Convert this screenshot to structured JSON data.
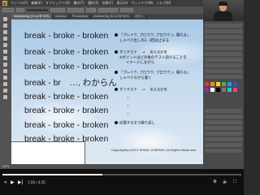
{
  "menu": {
    "app_logo": "Ai",
    "items": [
      "ファイル(F)",
      "編集(E)",
      "オブジェクト(O)",
      "書式(T)",
      "選択(S)",
      "効果(C)",
      "表示(V)",
      "ウィンドウ(W)",
      "ヘルプ(H)"
    ]
  },
  "tabs": [
    {
      "label": "shadowing_01.ai @ 50%",
      "active": true
    },
    {
      "label": "Ilstrator",
      "active": false
    },
    {
      "label": "Photoshop",
      "active": false
    },
    {
      "label": "shadowing_02.ai @ 50%",
      "active": false
    },
    {
      "label": "ボタン",
      "active": false
    }
  ],
  "phrases": [
    "break - broke - broken",
    "break - broke - broken",
    "break - broke - broken",
    "break - br　…, わからん",
    "break - broke - broken",
    "break - broke - braken",
    "break - broke - broken",
    "break - broke - broken"
  ],
  "notes": {
    "note1_line1": "「ブレイク, ブロウク, ブロウクン, 壊れる」",
    "note1_line2": "しゃべり出しの2, 3回は止まる",
    "note2_line1": "すぐテスト 　→ 　言えるかを",
    "note2_line2": "※ポイントはどの後のテスト読けることを",
    "note2_line3": "イメージしながら",
    "note3_line1": "「ブレイク, ブロウク, ブロウクン, 壊れる」",
    "note3_line2": "しゃべりながら書く",
    "note4_line1": "すぐテスト 　→ 　言えるかを",
    "note5_line1": "記憶するまで繰り返し",
    "dots": [
      "・",
      "・",
      "・"
    ]
  },
  "copyright": "Copyright(c)2015 NOMA COMPASS All Rights Reserved.",
  "status": {
    "zoom": "50%"
  },
  "player": {
    "progress": 0.42,
    "timecode": "1:56 / 4:35",
    "play_icon": "▶",
    "back_icon": "«",
    "next_icon": "▶|",
    "volume_icon": "🔈",
    "settings_icon": "⚙",
    "fullscreen_icon": "⛶"
  },
  "colors": {
    "accent": "#e8a33a",
    "swatches": [
      "#e23b2e",
      "#f08a24",
      "#f6d22b",
      "#4caf50",
      "#2196f3",
      "#3f51b5",
      "#9c27b0",
      "#ffffff",
      "#000000",
      "#8d6e63",
      "#26c6da",
      "#ec407a"
    ]
  }
}
